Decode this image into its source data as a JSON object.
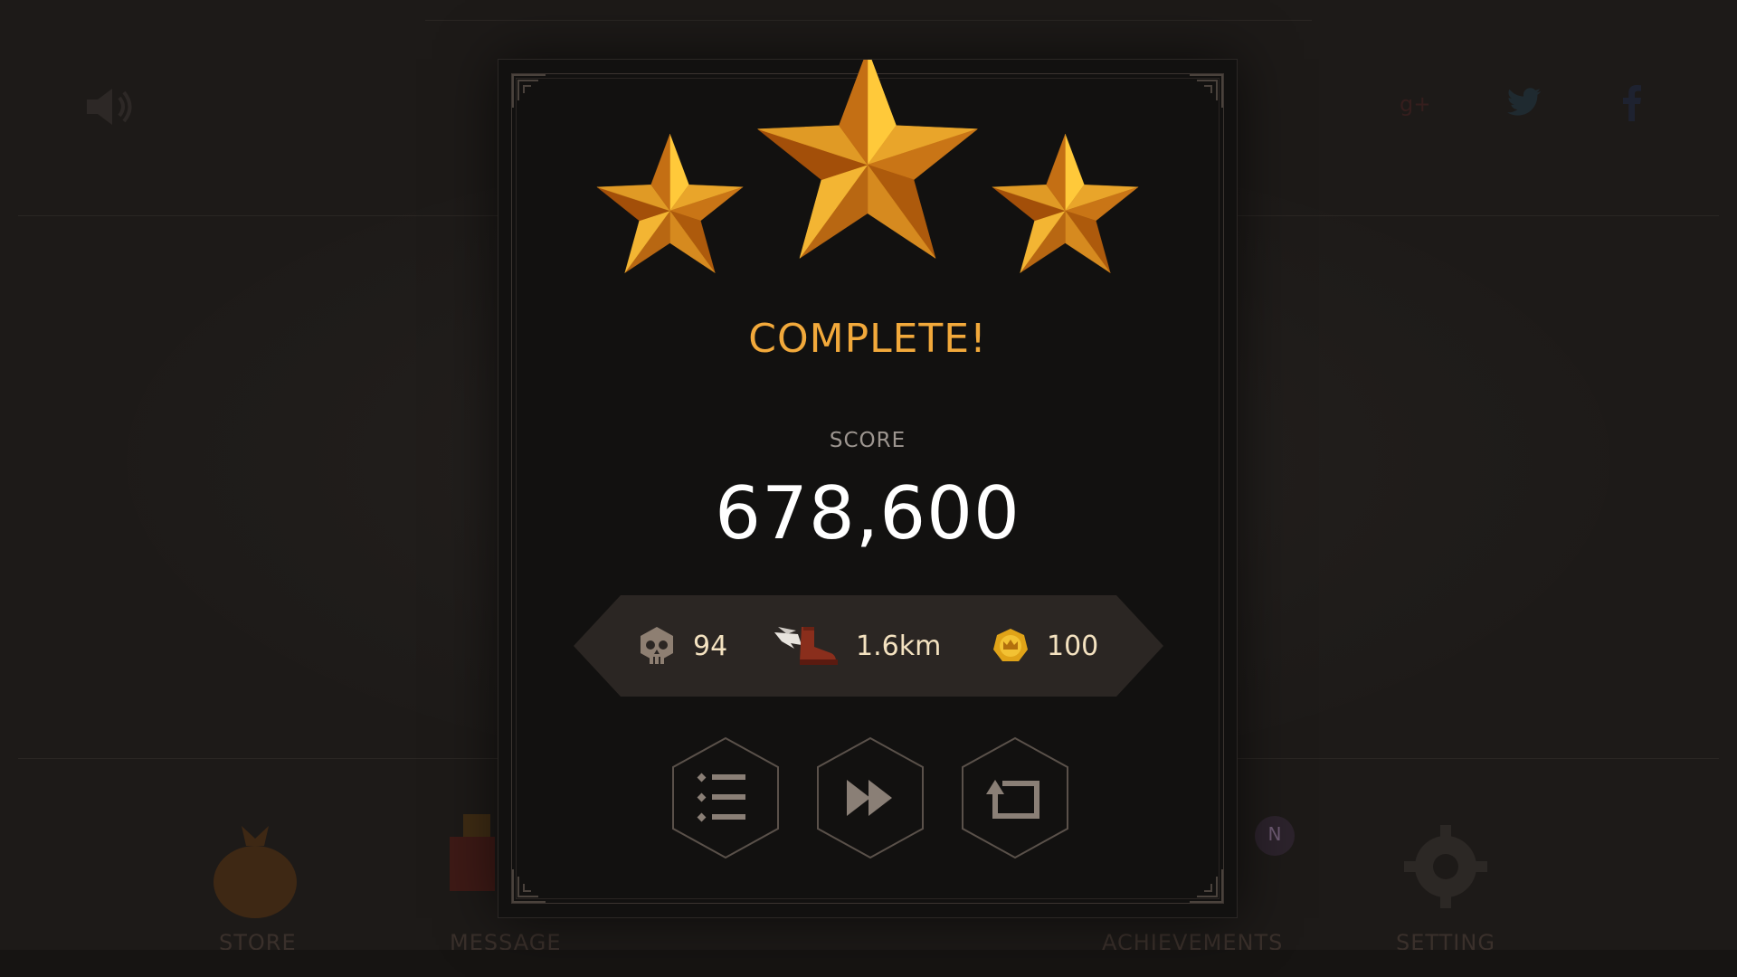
{
  "background": {
    "menu": [
      "STORE",
      "MESSAGE",
      "ACHIEVEMENTS",
      "SETTING"
    ],
    "badge": "N"
  },
  "result": {
    "stars_earned": 3,
    "stars_total": 3,
    "title": "COMPLETE!",
    "score_label": "SCORE",
    "score": "678,600"
  },
  "stats": {
    "kills": "94",
    "distance": "1.6km",
    "coins": "100"
  },
  "buttons": [
    "list-icon",
    "fast-forward-icon",
    "retry-icon"
  ],
  "colors": {
    "accent": "#f2a93b",
    "star_light": "#ffc93a",
    "star_dark": "#9e4a08",
    "panel": "#121110",
    "stat_bar": "#2b2623",
    "button_outline": "#5a514a"
  }
}
